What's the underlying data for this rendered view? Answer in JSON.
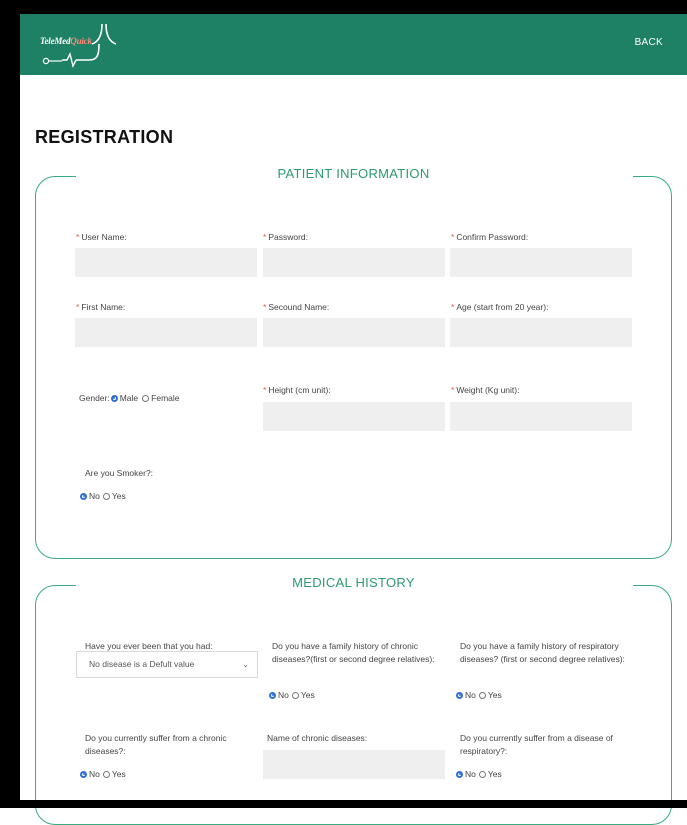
{
  "header": {
    "logo_text_a": "TeleMed",
    "logo_text_b": "Quick",
    "back_label": "BACK",
    "color": "#1e8064"
  },
  "page_title": "REGISTRATION",
  "patient_info": {
    "title": "PATIENT INFORMATION",
    "fields": {
      "user_name": "User Name:",
      "password": "Password:",
      "confirm_password": "Confirm Password:",
      "first_name": "First Name:",
      "second_name": "Secound Name:",
      "age": "Age (start from 20 year):",
      "height": "Height (cm unit):",
      "weight": "Weight (Kg unit):"
    },
    "gender_label": "Gender:",
    "gender_options": {
      "male": "Male",
      "female": "Female",
      "selected": "Male"
    },
    "smoker_label": "Are you Smoker?:",
    "smoker_options": {
      "no": "No",
      "yes": "Yes",
      "selected": "No"
    }
  },
  "medical_history": {
    "title": "MEDICAL HISTORY",
    "disease_label": "Have you ever been that you had:",
    "disease_select_value": "No disease is a Defult value",
    "family_chronic_label": "Do you have a family history of chronic diseases?(first or second degree relatives):",
    "family_respiratory_label": "Do you have a family history of respiratory diseases? (first or second degree relatives):",
    "chronic_label": "Do you currently suffer from a chronic diseases?:",
    "chronic_names_label": "Name of chronic diseases:",
    "respiratory_label": "Do you currently suffer from a disease of respiratory?:",
    "no": "No",
    "yes": "Yes"
  },
  "required_mark": "*",
  "accent_color": "#3aaa7f"
}
